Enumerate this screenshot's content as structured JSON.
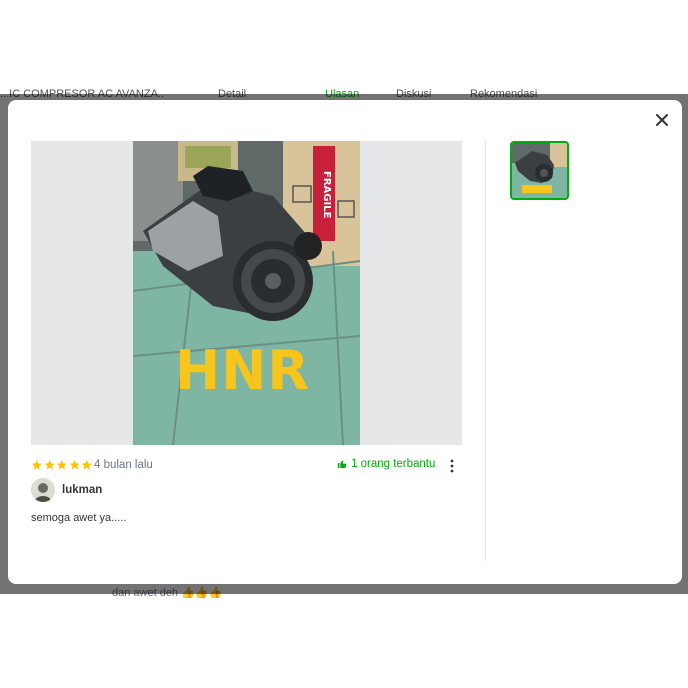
{
  "background": {
    "tabs": [
      "...IC COMPRESOR AC AVANZA..",
      "Detail",
      "Ulasan",
      "Diskusi",
      "Rekomendasi"
    ],
    "bottom_text": "dan awet deh 👍👍👍"
  },
  "modal": {
    "main_image": {
      "watermark": "HNR",
      "box_label": "FRAGILE"
    },
    "review": {
      "rating": 5,
      "time_ago": "4 bulan lalu",
      "helpful_text": "1 orang terbantu",
      "username": "lukman",
      "text": "semoga awet ya....."
    }
  },
  "colors": {
    "accent_green": "#03ac0e",
    "star_yellow": "#ffc400",
    "watermark_yellow": "#f7c51b"
  },
  "icons": {
    "close": "close-icon",
    "star": "star-icon",
    "helpful": "thumbs-up-icon",
    "more": "kebab-menu-icon"
  }
}
